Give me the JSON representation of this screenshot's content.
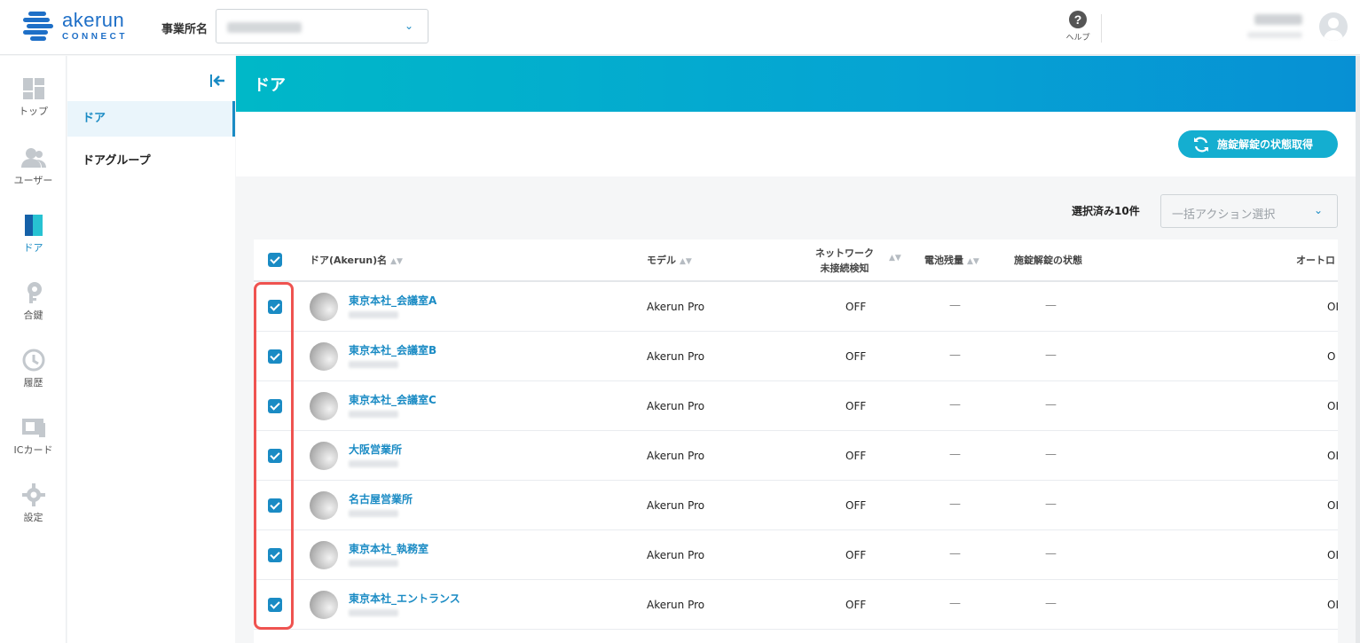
{
  "app": {
    "logo_word": "akerun",
    "logo_sub": "CONNECT"
  },
  "header": {
    "office_label": "事業所名",
    "help_label": "ヘルプ"
  },
  "nav": {
    "items": [
      {
        "label": "トップ"
      },
      {
        "label": "ユーザー"
      },
      {
        "label": "ドア"
      },
      {
        "label": "合鍵"
      },
      {
        "label": "履歴"
      },
      {
        "label": "ICカード"
      },
      {
        "label": "設定"
      }
    ]
  },
  "subnav": {
    "items": [
      {
        "label": "ドア"
      },
      {
        "label": "ドアグループ"
      }
    ]
  },
  "page": {
    "title": "ドア",
    "status_button": "施錠解錠の状態取得",
    "selected_count": "選択済み10件",
    "bulk_placeholder": "一括アクション選択"
  },
  "table": {
    "headers": {
      "name": "ドア(Akerun)名",
      "model": "モデル",
      "network_1": "ネットワーク",
      "network_2": "未接続検知",
      "battery": "電池残量",
      "lock_state": "施錠解錠の状態",
      "auto": "オートロ"
    },
    "rows": [
      {
        "name": "東京本社_会議室A",
        "model": "Akerun Pro",
        "network": "OFF",
        "battery": "—",
        "lock": "—",
        "auto": "OI"
      },
      {
        "name": "東京本社_会議室B",
        "model": "Akerun Pro",
        "network": "OFF",
        "battery": "—",
        "lock": "—",
        "auto": "O"
      },
      {
        "name": "東京本社_会議室C",
        "model": "Akerun Pro",
        "network": "OFF",
        "battery": "—",
        "lock": "—",
        "auto": "OI"
      },
      {
        "name": "大阪営業所",
        "model": "Akerun Pro",
        "network": "OFF",
        "battery": "—",
        "lock": "—",
        "auto": "OI"
      },
      {
        "name": "名古屋営業所",
        "model": "Akerun Pro",
        "network": "OFF",
        "battery": "—",
        "lock": "—",
        "auto": "OI"
      },
      {
        "name": "東京本社_執務室",
        "model": "Akerun Pro",
        "network": "OFF",
        "battery": "—",
        "lock": "—",
        "auto": "OI"
      },
      {
        "name": "東京本社_エントランス",
        "model": "Akerun Pro",
        "network": "OFF",
        "battery": "—",
        "lock": "—",
        "auto": "OI"
      }
    ]
  },
  "colors": {
    "accent": "#1a8bc4",
    "banner_start": "#00b8c8",
    "banner_end": "#0790d4",
    "highlight": "#ef5350"
  }
}
